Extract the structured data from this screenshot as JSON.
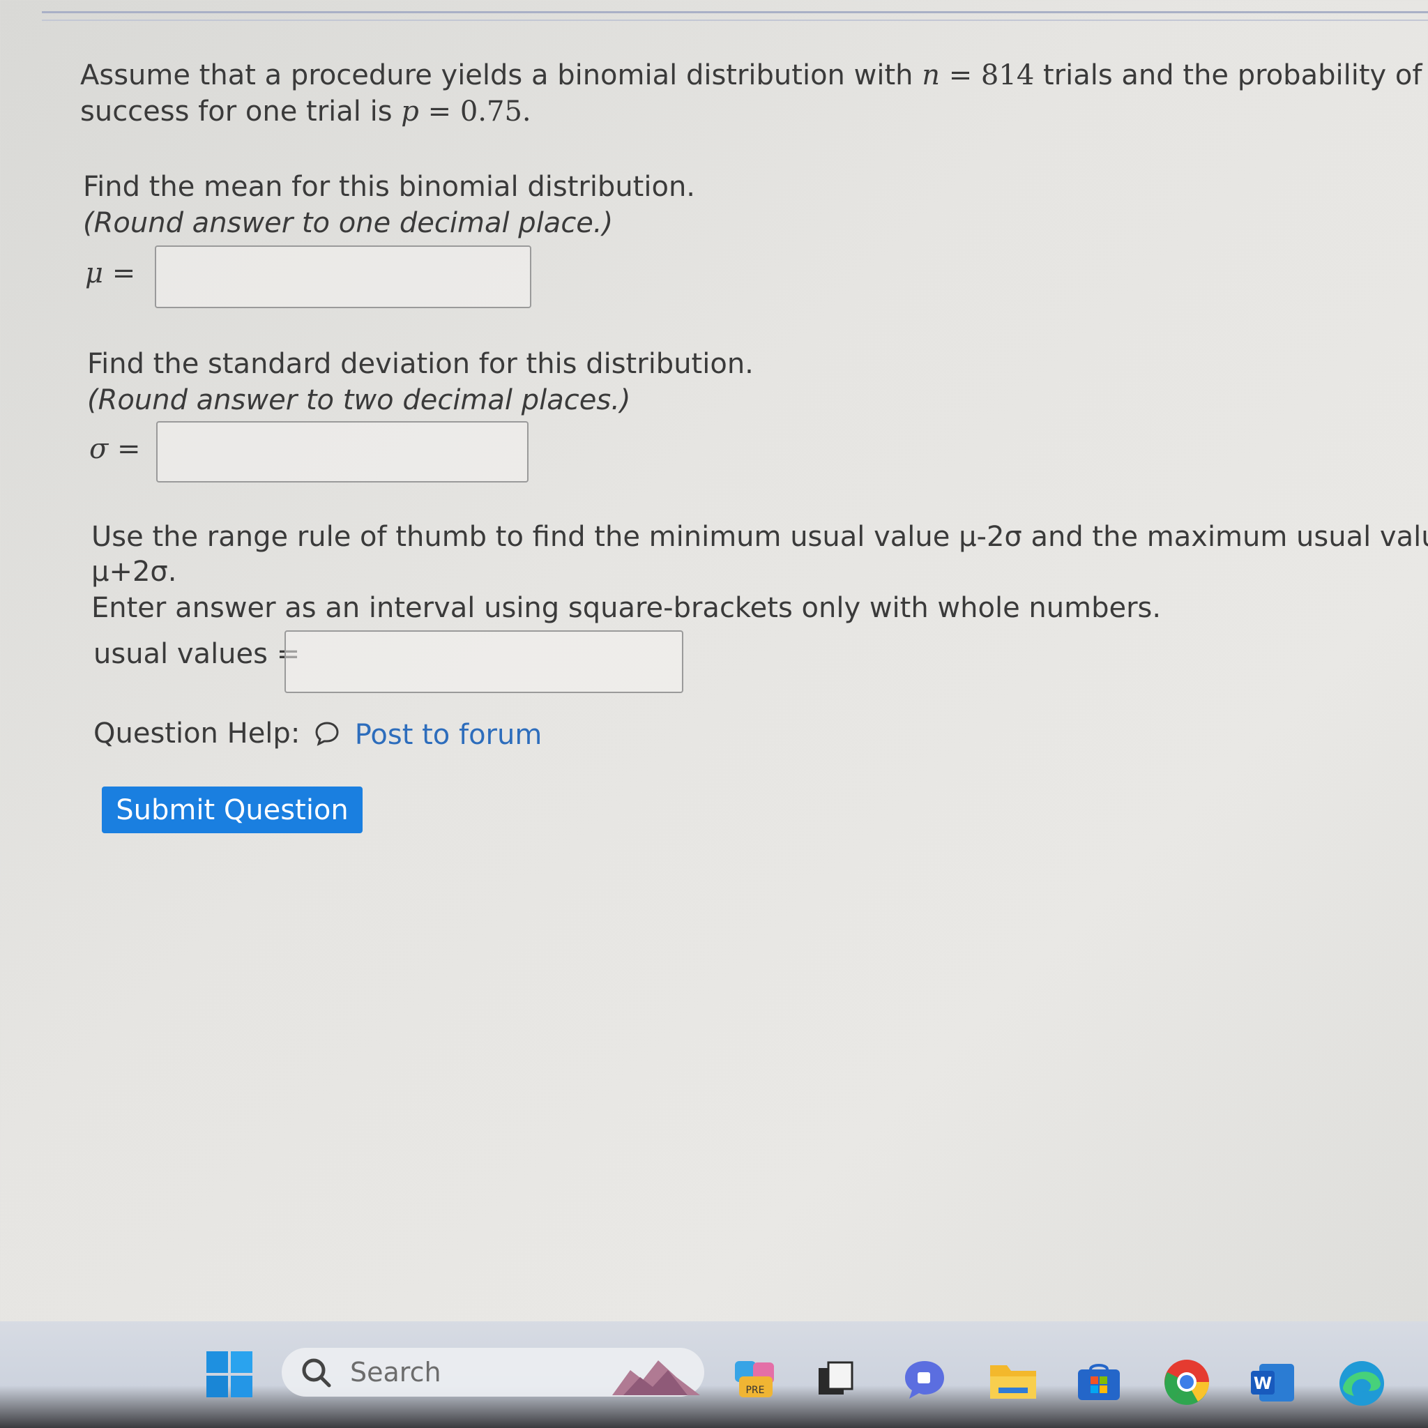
{
  "question": {
    "intro_prefix": "Assume that a procedure yields a binomial distribution with",
    "n_symbol": "n",
    "n_value": "814",
    "intro_middle": "trials and the probability of",
    "intro_line2_prefix": "success for one trial is",
    "p_symbol": "p",
    "p_value": "0.75.",
    "equals": "=",
    "mean_prompt": "Find the mean for this binomial distribution.",
    "mean_round": "(Round answer to one decimal place.)",
    "mean_symbol": "μ",
    "mean_value": "",
    "sd_prompt": "Find the standard deviation for this distribution.",
    "sd_round": "(Round answer to two decimal places.)",
    "sd_symbol": "σ",
    "sd_value": "",
    "range_prompt_line1": "Use the range rule of thumb to find the minimum usual value μ-2σ and the maximum usual value",
    "range_prompt_line2": "μ+2σ.",
    "range_instruction": "Enter answer as an interval using square-brackets only with whole numbers.",
    "usual_values_label": "usual values =",
    "usual_values_value": ""
  },
  "help": {
    "label": "Question Help:",
    "forum_icon": "speech-bubble-icon",
    "forum_link": "Post to forum"
  },
  "submit_label": "Submit Question",
  "taskbar": {
    "search_placeholder": "Search",
    "icons": [
      "windows-start-icon",
      "search-icon",
      "widgets-icon",
      "copilot-icon",
      "task-view-icon",
      "chat-icon",
      "file-explorer-icon",
      "store-icon",
      "chrome-icon",
      "word-icon",
      "edge-icon"
    ],
    "copilot_badge": "PRE",
    "word_letter": "W"
  },
  "colors": {
    "accent": "#1a7fe0",
    "link": "#2d6dbc"
  }
}
